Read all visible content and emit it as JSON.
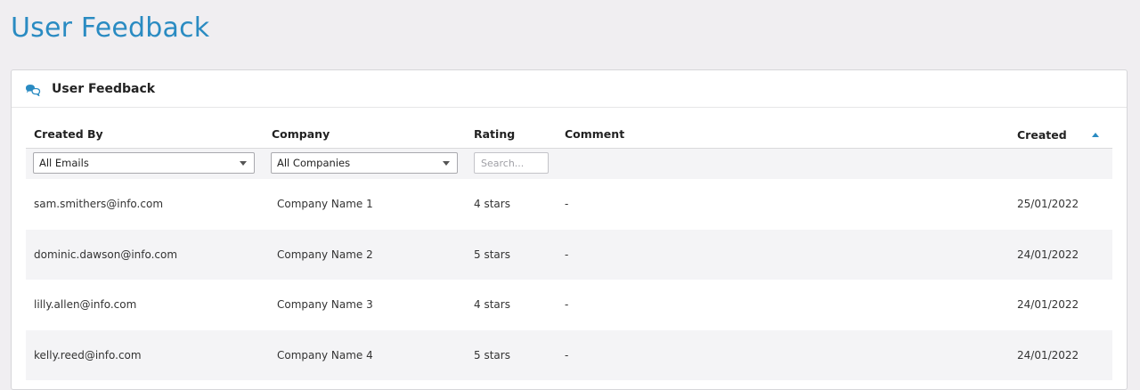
{
  "page": {
    "title": "User Feedback"
  },
  "card": {
    "title": "User Feedback",
    "icon": "chat-bubbles-icon"
  },
  "columns": {
    "created_by": "Created By",
    "company": "Company",
    "rating": "Rating",
    "comment": "Comment",
    "created": "Created"
  },
  "filters": {
    "emails_selected": "All Emails",
    "companies_selected": "All Companies",
    "rating_search_placeholder": "Search..."
  },
  "rows": [
    {
      "created_by": "sam.smithers@info.com",
      "company": "Company Name 1",
      "rating": "4 stars",
      "comment": "-",
      "created": "25/01/2022"
    },
    {
      "created_by": "dominic.dawson@info.com",
      "company": "Company Name 2",
      "rating": "5 stars",
      "comment": "-",
      "created": "24/01/2022"
    },
    {
      "created_by": "lilly.allen@info.com",
      "company": "Company Name 3",
      "rating": "4 stars",
      "comment": "-",
      "created": "24/01/2022"
    },
    {
      "created_by": "kelly.reed@info.com",
      "company": "Company Name 4",
      "rating": "5 stars",
      "comment": "-",
      "created": "24/01/2022"
    }
  ],
  "colors": {
    "accent": "#2a8bc2",
    "background": "#f0eef1",
    "row_alt": "#f4f4f6"
  }
}
